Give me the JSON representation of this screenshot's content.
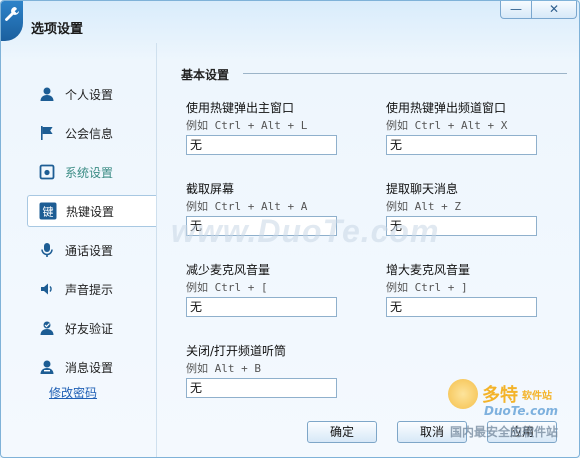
{
  "window": {
    "title": "选项设置",
    "minimize_icon": "minimize-icon",
    "close_icon": "close-icon"
  },
  "sidebar": {
    "items": [
      {
        "label": "个人设置",
        "icon": "person-icon"
      },
      {
        "label": "公会信息",
        "icon": "flag-icon"
      },
      {
        "label": "系统设置",
        "icon": "system-icon"
      },
      {
        "label": "热键设置",
        "icon": "hotkey-icon"
      },
      {
        "label": "通话设置",
        "icon": "microphone-icon"
      },
      {
        "label": "声音提示",
        "icon": "speaker-icon"
      },
      {
        "label": "好友验证",
        "icon": "friend-verify-icon"
      },
      {
        "label": "消息设置",
        "icon": "message-icon"
      }
    ],
    "change_password": "修改密码"
  },
  "section": {
    "title": "基本设置"
  },
  "fields": [
    {
      "label": "使用热键弹出主窗口",
      "hint": "例如 Ctrl + Alt + L",
      "value": "无"
    },
    {
      "label": "使用热键弹出频道窗口",
      "hint": "例如 Ctrl + Alt + X",
      "value": "无"
    },
    {
      "label": "截取屏幕",
      "hint": "例如 Ctrl + Alt + A",
      "value": "无"
    },
    {
      "label": "提取聊天消息",
      "hint": "例如 Alt + Z",
      "value": "无"
    },
    {
      "label": "减少麦克风音量",
      "hint": "例如 Ctrl + [",
      "value": "无"
    },
    {
      "label": "增大麦克风音量",
      "hint": "例如 Ctrl + ]",
      "value": "无"
    },
    {
      "label": "关闭/打开频道听筒",
      "hint": "例如 Alt + B",
      "value": "无"
    }
  ],
  "buttons": {
    "ok": "确定",
    "cancel": "取消",
    "apply": "应用"
  },
  "watermarks": {
    "center": "www.DuoTe.com",
    "logo_main": "多特",
    "logo_sub": "软件站",
    "logo_domain": "DuoTe.com",
    "logo_tagline": "国内最安全的软件站"
  },
  "colors": {
    "accent": "#2d83c9",
    "link": "#1f5fb5",
    "muted_nav": "#3a8c84"
  }
}
